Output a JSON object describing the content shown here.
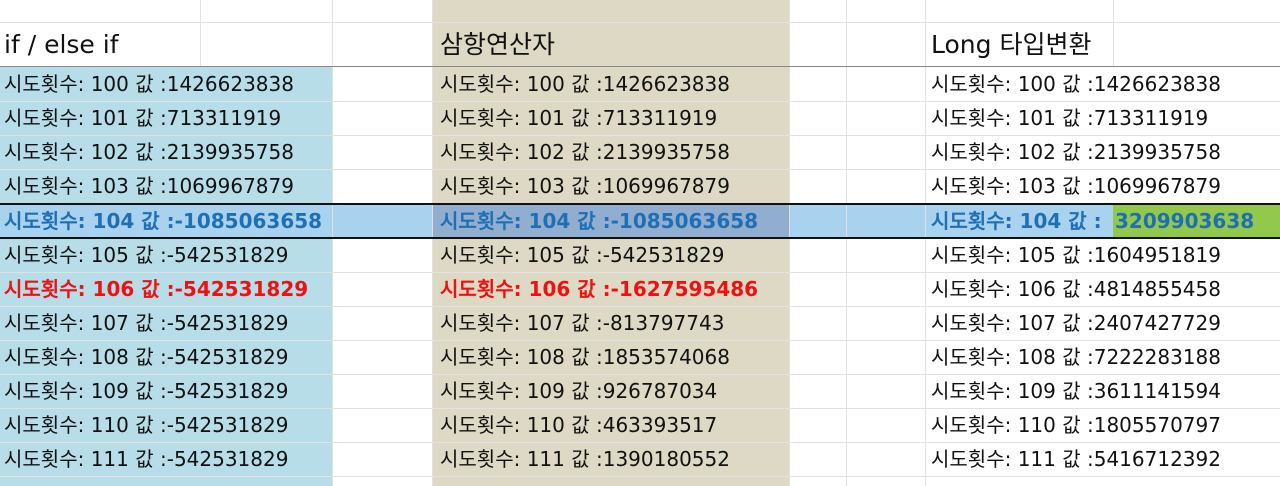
{
  "headers": {
    "col1": "if / else if",
    "col2": "삼항연산자",
    "col3": "Long 타입변환"
  },
  "colors": {
    "col1_fill": "#b7dde8",
    "col2_fill": "#ddd9c4",
    "selected_row": "#a9d2ee",
    "selected_text": "#1f6fb5",
    "error_text": "#ee1111",
    "green_cell": "#92c84b"
  },
  "rows": [
    {
      "col1": "시도횟수: 100 값 :1426623838",
      "col2": "시도횟수: 100 값 :1426623838",
      "col3": "시도횟수: 100 값 :1426623838"
    },
    {
      "col1": "시도횟수: 101 값 :713311919",
      "col2": "시도횟수: 101 값 :713311919",
      "col3": "시도횟수: 101 값 :713311919"
    },
    {
      "col1": "시도횟수: 102 값 :2139935758",
      "col2": "시도횟수: 102 값 :2139935758",
      "col3": "시도횟수: 102 값 :2139935758"
    },
    {
      "col1": "시도횟수: 103 값 :1069967879",
      "col2": "시도횟수: 103 값 :1069967879",
      "col3": "시도횟수: 103 값 :1069967879"
    },
    {
      "col1": "시도횟수: 104 값 :-1085063658",
      "col2": "시도횟수: 104 값 :-1085063658",
      "col3a": "시도횟수: 104 값 :",
      "col3b": "3209903638"
    },
    {
      "col1": "시도횟수: 105 값 :-542531829",
      "col2": "시도횟수: 105 값 :-542531829",
      "col3": "시도횟수: 105 값 :1604951819"
    },
    {
      "col1": "시도횟수: 106 값 :-542531829",
      "col2": "시도횟수: 106 값 :-1627595486",
      "col3": "시도횟수: 106 값 :4814855458"
    },
    {
      "col1": "시도횟수: 107 값 :-542531829",
      "col2": "시도횟수: 107 값 :-813797743",
      "col3": "시도횟수: 107 값 :2407427729"
    },
    {
      "col1": "시도횟수: 108 값 :-542531829",
      "col2": "시도횟수: 108 값 :1853574068",
      "col3": "시도횟수: 108 값 :7222283188"
    },
    {
      "col1": "시도횟수: 109 값 :-542531829",
      "col2": "시도횟수: 109 값 :926787034",
      "col3": "시도횟수: 109 값 :3611141594"
    },
    {
      "col1": "시도횟수: 110 값 :-542531829",
      "col2": "시도횟수: 110 값 :463393517",
      "col3": "시도횟수: 110 값 :1805570797"
    },
    {
      "col1": "시도횟수: 111 값 :-542531829",
      "col2": "시도횟수: 111 값 :1390180552",
      "col3": "시도횟수: 111 값 :5416712392"
    }
  ]
}
